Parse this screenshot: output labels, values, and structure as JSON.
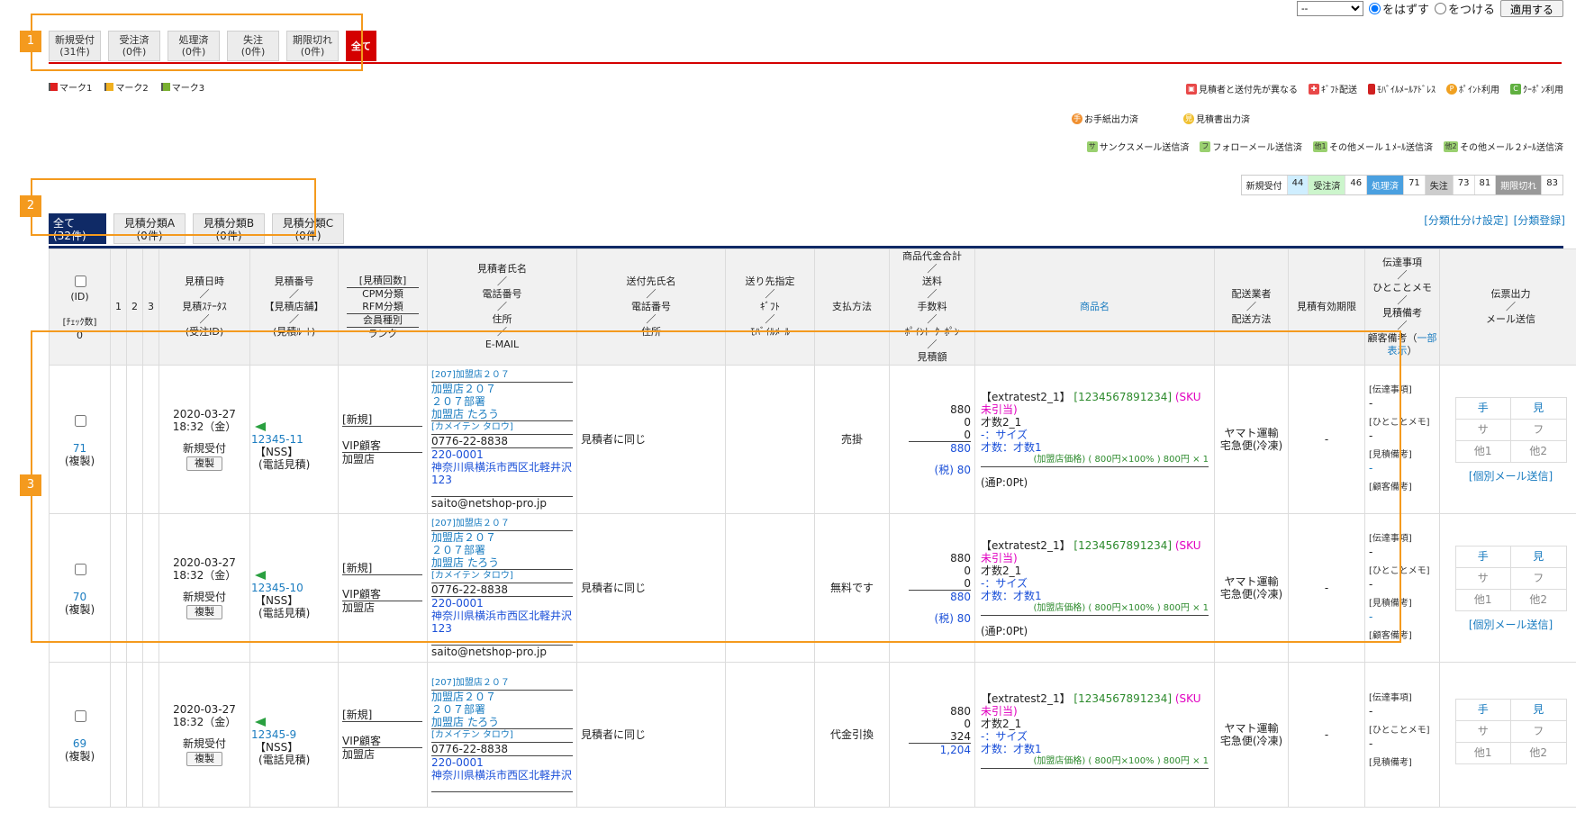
{
  "bulk": {
    "select_value": "--",
    "radio_off": "をはずす",
    "radio_on": "をつける",
    "apply": "適用する"
  },
  "status_tabs": [
    {
      "label": "新規受付",
      "count": "(31件)"
    },
    {
      "label": "受注済",
      "count": "(0件)"
    },
    {
      "label": "処理済",
      "count": "(0件)"
    },
    {
      "label": "失注",
      "count": "(0件)"
    },
    {
      "label": "期限切れ",
      "count": "(0件)"
    },
    {
      "label": "全て",
      "count": ""
    }
  ],
  "marks": [
    "マーク1",
    "マーク2",
    "マーク3"
  ],
  "legend1": [
    "見積者と送付先が異なる",
    "ｷﾞﾌﾄ配送",
    "ﾓﾊﾞｲﾙﾒｰﾙｱﾄﾞﾚｽ",
    "ﾎﾟｲﾝﾄ利用",
    "ｸｰﾎﾟﾝ利用"
  ],
  "legend2": [
    "お手紙出力済",
    "見積書出力済"
  ],
  "legend3": [
    {
      "icon": "サ",
      "label": "サンクスメール送信済"
    },
    {
      "icon": "フ",
      "label": "フォローメール送信済"
    },
    {
      "icon": "他1",
      "label": "その他メール１ﾒｰﾙ送信済"
    },
    {
      "icon": "他2",
      "label": "その他メール２ﾒｰﾙ送信済"
    }
  ],
  "counts": [
    {
      "label": "新規受付",
      "value": "44"
    },
    {
      "label": "受注済",
      "value": "46"
    },
    {
      "label": "処理済",
      "value": "71"
    },
    {
      "label": "失注",
      "value": "73"
    },
    {
      "label": "",
      "value": "81"
    },
    {
      "label": "期限切れ",
      "value": "83"
    }
  ],
  "category_tabs": [
    {
      "label": "全て",
      "count": "(32件)"
    },
    {
      "label": "見積分類A",
      "count": "(0件)"
    },
    {
      "label": "見積分類B",
      "count": "(0件)"
    },
    {
      "label": "見積分類C",
      "count": "(0件)"
    }
  ],
  "category_links": [
    "[分類仕分け設定]",
    "[分類登録]"
  ],
  "headers": {
    "id": [
      "(ID)",
      "[ﾁｪｯｸ数]",
      "0"
    ],
    "marks": [
      "1",
      "2",
      "3"
    ],
    "date": [
      "見積日時",
      "／",
      "見積ｽﾃｰﾀｽ",
      "／",
      "(受注ID)"
    ],
    "number": [
      "見積番号",
      "／",
      "【見積店舗】",
      "／",
      "(見積ﾙｰﾄ)"
    ],
    "count": [
      "[見積回数]",
      "CPM分類",
      "RFM分類",
      "会員種別",
      "ランク"
    ],
    "customer": [
      "見積者氏名",
      "／",
      "電話番号",
      "／",
      "住所",
      "／",
      "E-MAIL"
    ],
    "dest": [
      "送付先氏名",
      "／",
      "電話番号",
      "／",
      "住所"
    ],
    "spec": [
      "送り先指定",
      "／",
      "ｷﾞﾌﾄ",
      "／",
      "ﾓﾊﾞｲﾙﾒｰﾙ"
    ],
    "payment": "支払方法",
    "amount": [
      "商品代金合計",
      "／",
      "送料",
      "／",
      "手数料",
      "／",
      "ﾎﾟｲﾝﾄ･ｸｰﾎﾟﾝ",
      "／",
      "見積額"
    ],
    "product": "商品名",
    "shipper": [
      "配送業者",
      "／",
      "配送方法"
    ],
    "expiry": "見積有効期限",
    "notes": [
      "伝達事項",
      "／",
      "ひとことメモ",
      "／",
      "見積備考",
      "／",
      "顧客備考（",
      "一部表示",
      "）"
    ],
    "output": [
      "伝票出力",
      "／",
      "メール送信"
    ]
  },
  "rows": [
    {
      "id": "71",
      "copy_tag": "(複製)",
      "date": "2020-03-27",
      "time": "18:32（金）",
      "status": "新規受付",
      "copy_btn": "複製",
      "number": "12345-11",
      "shop": "【NSS】",
      "route": "(電話見積)",
      "visit": "[新規]",
      "member": "VIP顧客",
      "rank": "加盟店",
      "c_shop": "[207]加盟店２０７",
      "c_company": "加盟店２０７",
      "c_dept": "２０７部署",
      "c_name": "加盟店 たろう",
      "c_kana": "[カメイテン タロウ]",
      "c_tel": "0776-22-8838",
      "c_zip": "220-0001",
      "c_addr": "神奈川県横浜市西区北軽井沢123",
      "c_mail": "saito@netshop-pro.jp",
      "dest": "見積者に同じ",
      "payment": "売掛",
      "a_goods": "880",
      "a_ship": "0",
      "a_fee": "0",
      "a_total": "880",
      "a_tax": "(税) 80",
      "p_name": "【extratest2_1】",
      "p_code": "[1234567891234]",
      "p_sku": "(SKU未引当)",
      "p_line1": "才数2_1",
      "p_line2": "-：サイズ",
      "p_line3": "才数：才数1",
      "p_price": "(加盟店価格) ( 800円×100% ) 800円 × 1",
      "p_point": "(通P:0Pt)",
      "shipper": "ヤマト運輸",
      "method": "宅急便(冷凍)",
      "expiry": "-",
      "n1": "[伝達事項]",
      "n1v": "-",
      "n2": "[ひとことメモ]",
      "n2v": "-",
      "n3": "[見積備考]",
      "n3v": "-",
      "n4": "[顧客備考]",
      "out": [
        "手",
        "見",
        "サ",
        "フ",
        "他1",
        "他2"
      ],
      "mail_link": "[個別メール送信]"
    },
    {
      "id": "70",
      "copy_tag": "(複製)",
      "date": "2020-03-27",
      "time": "18:32（金）",
      "status": "新規受付",
      "copy_btn": "複製",
      "number": "12345-10",
      "shop": "【NSS】",
      "route": "(電話見積)",
      "visit": "[新規]",
      "member": "VIP顧客",
      "rank": "加盟店",
      "c_shop": "[207]加盟店２０７",
      "c_company": "加盟店２０７",
      "c_dept": "２０７部署",
      "c_name": "加盟店 たろう",
      "c_kana": "[カメイテン タロウ]",
      "c_tel": "0776-22-8838",
      "c_zip": "220-0001",
      "c_addr": "神奈川県横浜市西区北軽井沢123",
      "c_mail": "saito@netshop-pro.jp",
      "dest": "見積者に同じ",
      "payment": "無料です",
      "a_goods": "880",
      "a_ship": "0",
      "a_fee": "0",
      "a_total": "880",
      "a_tax": "(税) 80",
      "p_name": "【extratest2_1】",
      "p_code": "[1234567891234]",
      "p_sku": "(SKU未引当)",
      "p_line1": "才数2_1",
      "p_line2": "-：サイズ",
      "p_line3": "才数：才数1",
      "p_price": "(加盟店価格) ( 800円×100% ) 800円 × 1",
      "p_point": "(通P:0Pt)",
      "shipper": "ヤマト運輸",
      "method": "宅急便(冷凍)",
      "expiry": "-",
      "n1": "[伝達事項]",
      "n1v": "-",
      "n2": "[ひとことメモ]",
      "n2v": "-",
      "n3": "[見積備考]",
      "n3v": "-",
      "n4": "[顧客備考]",
      "out": [
        "手",
        "見",
        "サ",
        "フ",
        "他1",
        "他2"
      ],
      "mail_link": "[個別メール送信]"
    },
    {
      "id": "69",
      "copy_tag": "(複製)",
      "date": "2020-03-27",
      "time": "18:32（金）",
      "status": "新規受付",
      "copy_btn": "複製",
      "number": "12345-9",
      "shop": "【NSS】",
      "route": "(電話見積)",
      "visit": "[新規]",
      "member": "VIP顧客",
      "rank": "加盟店",
      "c_shop": "[207]加盟店２０７",
      "c_company": "加盟店２０７",
      "c_dept": "２０７部署",
      "c_name": "加盟店 たろう",
      "c_kana": "[カメイテン タロウ]",
      "c_tel": "0776-22-8838",
      "c_zip": "220-0001",
      "c_addr": "神奈川県横浜市西区北軽井沢",
      "dest": "見積者に同じ",
      "payment": "代金引換",
      "a_goods": "880",
      "a_ship": "0",
      "a_fee": "324",
      "a_total": "1,204",
      "p_name": "【extratest2_1】",
      "p_code": "[1234567891234]",
      "p_sku": "(SKU未引当)",
      "p_line1": "才数2_1",
      "p_line2": "-：サイズ",
      "p_line3": "才数：才数1",
      "p_price": "(加盟店価格) ( 800円×100% ) 800円 × 1",
      "shipper": "ヤマト運輸",
      "method": "宅急便(冷凍)",
      "expiry": "-",
      "n1": "[伝達事項]",
      "n1v": "-",
      "n2": "[ひとことメモ]",
      "n2v": "-",
      "n3": "[見積備考]",
      "out": [
        "手",
        "見",
        "サ",
        "フ",
        "他1",
        "他2"
      ]
    }
  ],
  "annotations": [
    "1",
    "2",
    "3"
  ]
}
